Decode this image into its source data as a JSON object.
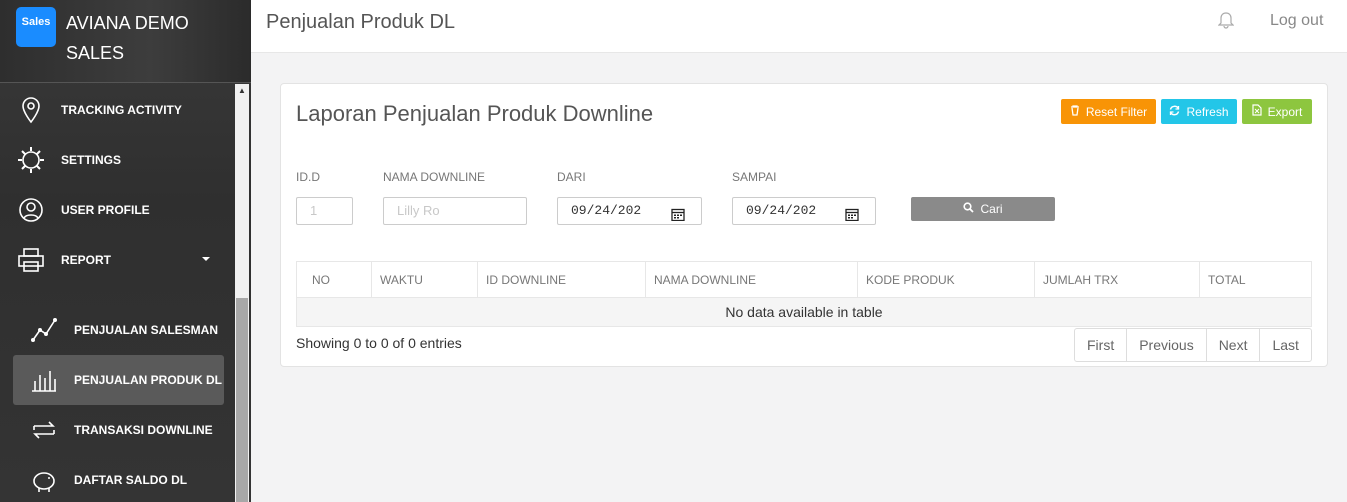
{
  "app": {
    "logo_text": "Sales",
    "brand_line1": "AVIANA DEMO",
    "brand_line2": "SALES"
  },
  "sidebar": {
    "items": [
      {
        "label": "TRACKING ACTIVITY",
        "icon": "location-pin-icon"
      },
      {
        "label": "SETTINGS",
        "icon": "gear-icon"
      },
      {
        "label": "USER PROFILE",
        "icon": "user-circle-icon"
      },
      {
        "label": "REPORT",
        "icon": "printer-icon"
      }
    ],
    "sub_items": [
      {
        "label": "PENJUALAN SALESMAN",
        "icon": "line-chart-icon"
      },
      {
        "label": "PENJUALAN PRODUK DL",
        "icon": "bar-chart-icon",
        "active": true
      },
      {
        "label": "TRANSAKSI DOWNLINE",
        "icon": "exchange-icon"
      },
      {
        "label": "DAFTAR SALDO DL",
        "icon": "piggy-bank-icon"
      }
    ]
  },
  "header": {
    "title": "Penjualan Produk DL",
    "logout_label": "Log out",
    "bell_icon": "bell-icon"
  },
  "card": {
    "title": "Laporan Penjualan Produk Downline",
    "buttons": {
      "reset": "Reset Filter",
      "refresh": "Refresh",
      "export": "Export"
    },
    "colors": {
      "reset": "#f89406",
      "refresh": "#23c6e8",
      "export": "#8dc63f"
    }
  },
  "filters": {
    "idd": {
      "label": "ID.D",
      "placeholder": "1"
    },
    "nama": {
      "label": "NAMA DOWNLINE",
      "placeholder": "Lilly Ro"
    },
    "dari": {
      "label": "DARI",
      "value": "09/24/202"
    },
    "sampai": {
      "label": "SAMPAI",
      "value": "09/24/202"
    },
    "search_label": "Cari"
  },
  "table": {
    "columns": [
      "NO",
      "WAKTU",
      "ID DOWNLINE",
      "NAMA DOWNLINE",
      "KODE PRODUK",
      "JUMLAH TRX",
      "TOTAL"
    ],
    "empty_message": "No data available in table"
  },
  "info": "Showing 0 to 0 of 0 entries",
  "pagination": {
    "first": "First",
    "previous": "Previous",
    "next": "Next",
    "last": "Last"
  }
}
